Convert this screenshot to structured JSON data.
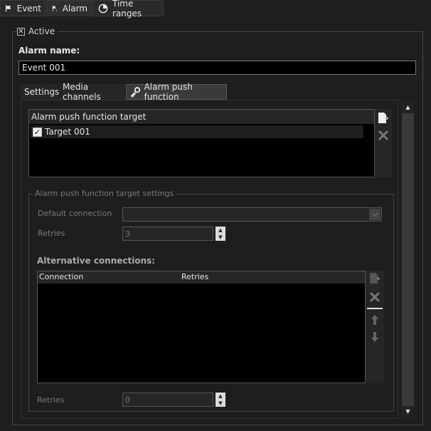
{
  "top_tabs": [
    {
      "label": "Event",
      "icon": "flag-icon"
    },
    {
      "label": "Alarm",
      "icon": "alarm-icon"
    },
    {
      "label": "Time ranges",
      "icon": "clock-icon"
    }
  ],
  "active": {
    "label": "Active",
    "checked": true
  },
  "alarm_name": {
    "label": "Alarm name:",
    "value": "Event 001"
  },
  "sub_tabs": [
    {
      "label": "Settings"
    },
    {
      "label": "Media channels"
    },
    {
      "label": "Alarm push function",
      "icon": "key-icon"
    }
  ],
  "targets": {
    "header": "Alarm push function target",
    "items": [
      {
        "label": "Target 001",
        "checked": true
      }
    ]
  },
  "target_settings": {
    "group_label": "Alarm push function target settings",
    "default_connection_label": "Default connection",
    "default_connection_value": "",
    "retries_label": "Retries",
    "retries_value": "3"
  },
  "alternative_connections": {
    "title": "Alternative connections:",
    "columns": [
      "Connection",
      "Retries"
    ]
  },
  "bottom_retries": {
    "label": "Retries",
    "value": "0"
  },
  "colors": {
    "background": "#1e1e1e",
    "list_bg": "#000000",
    "text": "#d4d4d4",
    "dim_text": "#7a7a7a"
  }
}
